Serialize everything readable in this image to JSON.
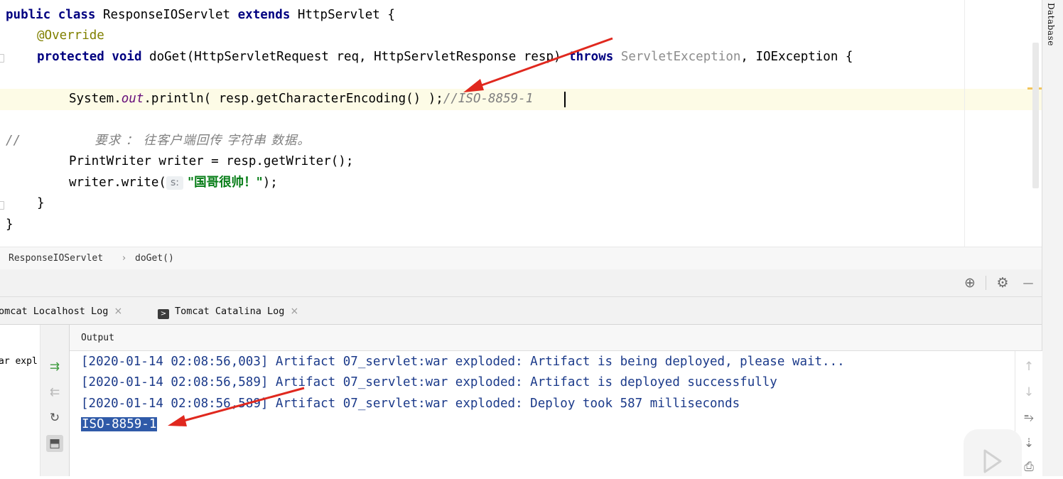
{
  "editor": {
    "lines": {
      "class_decl": {
        "kw1": "public class",
        "name": " ResponseIOServlet ",
        "kw2": "extends",
        "rest": " HttpServlet {"
      },
      "override": "@Override",
      "method": {
        "kw1": "protected void",
        "sig": " doGet(HttpServletRequest req, HttpServletResponse resp) ",
        "kw2": "throws",
        "exc1": " ServletException",
        "rest": ", IOException {"
      },
      "println": {
        "a": "System.",
        "b": "out",
        "c": ".println( resp.getCharacterEncoding() );",
        "comment": "//ISO-8859-1"
      },
      "comment_line": {
        "slashes": "//",
        "text": "要求 ： 往客户端回传 字符串 数据。"
      },
      "writer_decl": "PrintWriter writer = resp.getWriter();",
      "write_call": {
        "a": "writer.write(",
        "hint": "s:",
        "str": "\"国哥很帅！\"",
        "c": ");"
      },
      "close_method": "}",
      "close_class": "}"
    }
  },
  "right_stripe": {
    "database_tab": "Database"
  },
  "breadcrumb": {
    "class": "ResponseIOServlet",
    "sep": "›",
    "method": "doGet()"
  },
  "tool_header": {
    "crosshair_icon": "⊕",
    "gear_icon": "⚙",
    "minimize_icon": "—"
  },
  "tabs": [
    {
      "label": "omcat Localhost Log",
      "close": "×"
    },
    {
      "label": "Tomcat Catalina Log",
      "close": "×",
      "icon_text": ">"
    }
  ],
  "left_col": {
    "text": "ar expl"
  },
  "output": {
    "header": "Output",
    "lines": [
      "[2020-01-14 02:08:56,003] Artifact 07_servlet:war exploded: Artifact is being deployed, please wait...",
      "[2020-01-14 02:08:56,589] Artifact 07_servlet:war exploded: Artifact is deployed successfully",
      "[2020-01-14 02:08:56,589] Artifact 07_servlet:war exploded: Deploy took 587 milliseconds"
    ],
    "selected": "ISO-8859-1"
  },
  "colors": {
    "keyword": "#000080",
    "annotation": "#808000",
    "string": "#067d17",
    "selection": "#2f5aa8",
    "arrow": "#e0281e"
  }
}
